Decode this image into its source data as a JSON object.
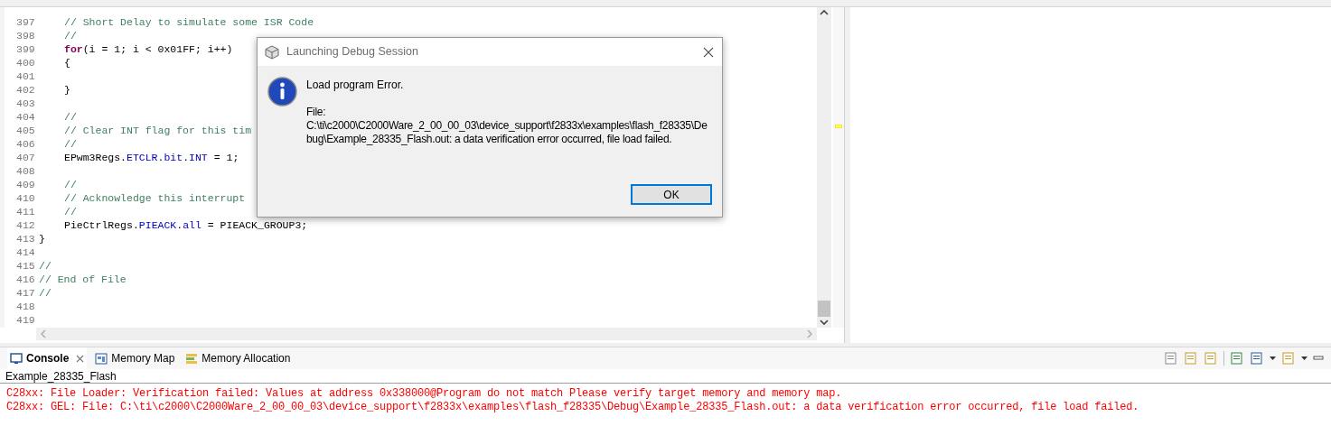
{
  "editor": {
    "lines": [
      {
        "number": "397",
        "indented": true,
        "tokens": [
          {
            "kind": "comment",
            "text": "// Short Delay to simulate some ISR Code"
          }
        ]
      },
      {
        "number": "398",
        "indented": true,
        "tokens": [
          {
            "kind": "comment",
            "text": "//"
          }
        ]
      },
      {
        "number": "399",
        "indented": true,
        "tokens": [
          {
            "kind": "keyword",
            "text": "for"
          },
          {
            "kind": "plain",
            "text": "(i = 1; i < 0x01FF; i++)"
          }
        ]
      },
      {
        "number": "400",
        "indented": true,
        "tokens": [
          {
            "kind": "plain",
            "text": "{"
          }
        ]
      },
      {
        "number": "401"
      },
      {
        "number": "402",
        "indented": true,
        "tokens": [
          {
            "kind": "plain",
            "text": "}"
          }
        ]
      },
      {
        "number": "403"
      },
      {
        "number": "404",
        "indented": true,
        "tokens": [
          {
            "kind": "comment",
            "text": "//"
          }
        ]
      },
      {
        "number": "405",
        "indented": true,
        "tokens": [
          {
            "kind": "comment",
            "text": "// Clear INT flag for this tim"
          }
        ]
      },
      {
        "number": "406",
        "indented": true,
        "tokens": [
          {
            "kind": "comment",
            "text": "//"
          }
        ]
      },
      {
        "number": "407",
        "indented": true,
        "tokens": [
          {
            "kind": "plain",
            "text": "EPwm3Regs."
          },
          {
            "kind": "field",
            "text": "ETCLR"
          },
          {
            "kind": "plain",
            "text": "."
          },
          {
            "kind": "field",
            "text": "bit"
          },
          {
            "kind": "plain",
            "text": "."
          },
          {
            "kind": "field",
            "text": "INT"
          },
          {
            "kind": "plain",
            "text": " = 1;"
          }
        ]
      },
      {
        "number": "408"
      },
      {
        "number": "409",
        "indented": true,
        "tokens": [
          {
            "kind": "comment",
            "text": "//"
          }
        ]
      },
      {
        "number": "410",
        "indented": true,
        "tokens": [
          {
            "kind": "comment",
            "text": "// Acknowledge this interrupt"
          }
        ]
      },
      {
        "number": "411",
        "indented": true,
        "tokens": [
          {
            "kind": "comment",
            "text": "//"
          }
        ]
      },
      {
        "number": "412",
        "indented": true,
        "tokens": [
          {
            "kind": "plain",
            "text": "PieCtrlRegs."
          },
          {
            "kind": "field",
            "text": "PIEACK"
          },
          {
            "kind": "plain",
            "text": "."
          },
          {
            "kind": "field",
            "text": "all"
          },
          {
            "kind": "plain",
            "text": " = PIEACK_GROUP3;"
          }
        ]
      },
      {
        "number": "413",
        "indented": false,
        "tokens": [
          {
            "kind": "plain",
            "text": "}"
          }
        ]
      },
      {
        "number": "414"
      },
      {
        "number": "415",
        "indented": false,
        "tokens": [
          {
            "kind": "comment",
            "text": "//"
          }
        ]
      },
      {
        "number": "416",
        "indented": false,
        "tokens": [
          {
            "kind": "comment",
            "text": "// End of File"
          }
        ]
      },
      {
        "number": "417",
        "indented": false,
        "tokens": [
          {
            "kind": "comment",
            "text": "//"
          }
        ]
      },
      {
        "number": "418"
      },
      {
        "number": "419"
      }
    ]
  },
  "dialog": {
    "title": "Launching Debug Session",
    "heading": "Load program Error.",
    "body": [
      "File:",
      "C:\\ti\\c2000\\C2000Ware_2_00_00_03\\device_support\\f2833x\\examples\\flash_f28335\\De",
      "bug\\Example_28335_Flash.out: a data verification error occurred, file load failed."
    ],
    "button": "OK"
  },
  "console": {
    "tabs": [
      {
        "label": "Console",
        "selected": true,
        "kind": "console"
      },
      {
        "label": "Memory Map",
        "selected": false,
        "kind": "map"
      },
      {
        "label": "Memory Allocation",
        "selected": false,
        "kind": "alloc"
      }
    ],
    "name": "Example_28335_Flash",
    "lines": [
      "C28xx: File Loader: Verification failed: Values at address 0x338000@Program do not match Please verify target memory and memory map.",
      "C28xx: GEL: File: C:\\ti\\c2000\\C2000Ware_2_00_00_03\\device_support\\f2833x\\examples\\flash_f28335\\Debug\\Example_28335_Flash.out: a data verification error occurred, file load failed."
    ]
  }
}
